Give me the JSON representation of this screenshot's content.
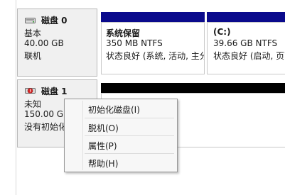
{
  "disks": [
    {
      "name": "磁盘 0",
      "type": "基本",
      "size": "40.00 GB",
      "status": "联机",
      "icon": "disk-icon",
      "partitions": [
        {
          "title": "系统保留",
          "size_fs": "350 MB NTFS",
          "status": "状态良好 (系统, 活动, 主分"
        },
        {
          "title": "(C:)",
          "size_fs": "39.66 GB NTFS",
          "status": "状态良好 (启动, 页面"
        }
      ]
    },
    {
      "name": "磁盘 1",
      "type": "未知",
      "size": "150.00 GB",
      "status": "没有初始化",
      "icon": "disk-warning-icon"
    }
  ],
  "context_menu": {
    "items": [
      "初始化磁盘(I)",
      "脱机(O)",
      "属性(P)",
      "帮助(H)"
    ]
  },
  "colors": {
    "primary_partition_bar": "#0a0a8c",
    "unallocated_bar": "#000000"
  }
}
